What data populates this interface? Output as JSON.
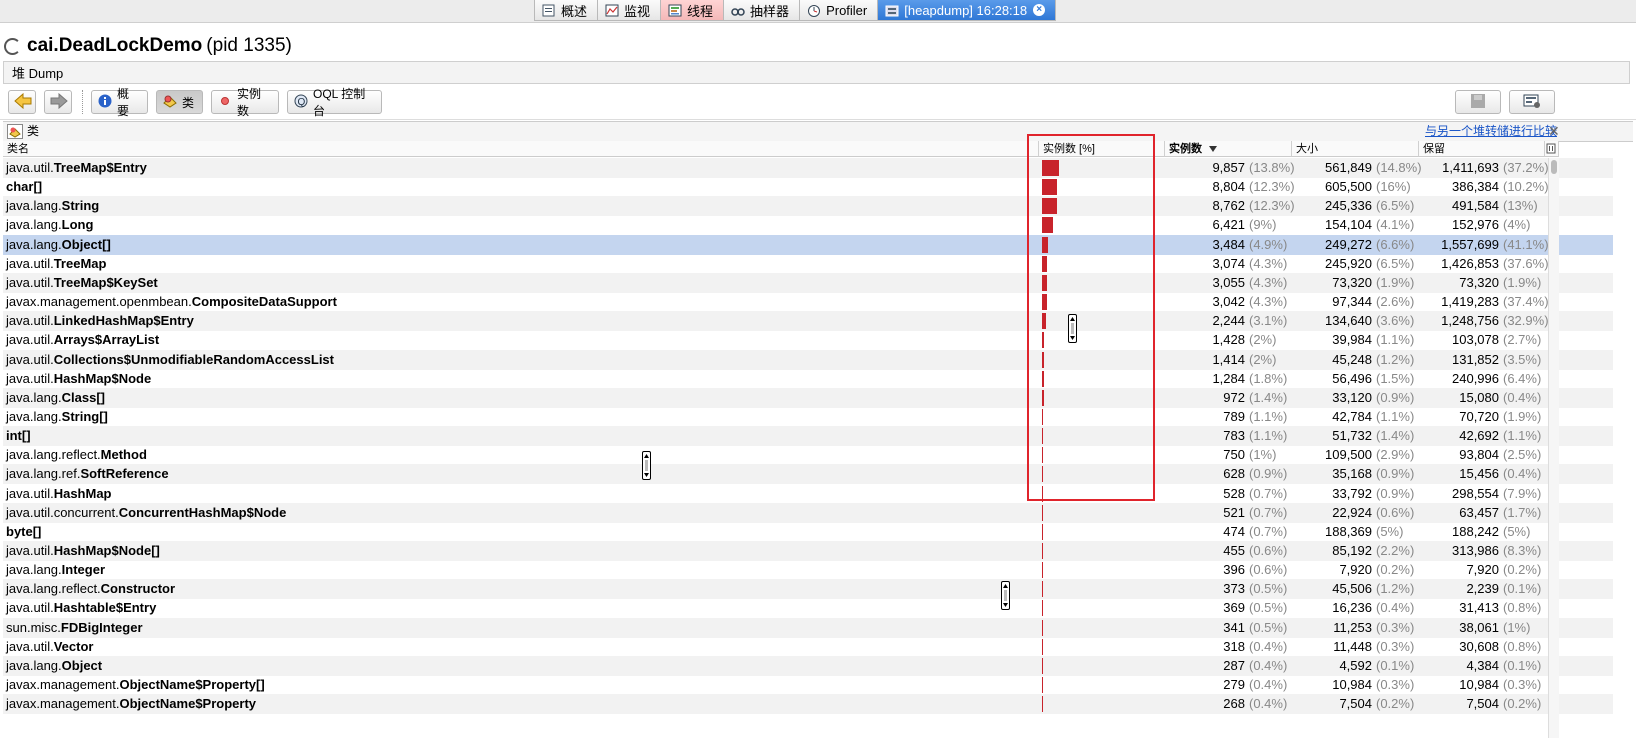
{
  "tabs": [
    {
      "label": "概述",
      "icon": "overview-icon"
    },
    {
      "label": "监视",
      "icon": "monitor-icon"
    },
    {
      "label": "线程",
      "icon": "threads-icon"
    },
    {
      "label": "抽样器",
      "icon": "sampler-icon"
    },
    {
      "label": "Profiler",
      "icon": "profiler-icon"
    },
    {
      "label": "[heapdump] 16:28:18",
      "icon": "heapdump-icon"
    }
  ],
  "app": {
    "name": "cai.DeadLockDemo",
    "pid": "(pid 1335)"
  },
  "heap_dump_label": "堆 Dump",
  "toolbar": {
    "summary": "概要",
    "classes": "类",
    "instances": "实例数",
    "oql": "OQL 控制台"
  },
  "classes_panel": {
    "title": "类",
    "compare_link": "与另一个堆转储进行比较"
  },
  "columns": {
    "name": "类名",
    "instances_pct": "实例数 [%]",
    "instances": "实例数",
    "size": "大小",
    "retained": "保留"
  },
  "rows": [
    {
      "pkg": "java.util.",
      "cls": "TreeMap$Entry",
      "bar": 13.8,
      "inst": "9,857",
      "inst_pct": "(13.8%)",
      "size": "561,849",
      "size_pct": "(14.8%)",
      "ret": "1,411,693",
      "ret_pct": "(37.2%)"
    },
    {
      "pkg": "",
      "cls": "char[]",
      "bar": 12.3,
      "inst": "8,804",
      "inst_pct": "(12.3%)",
      "size": "605,500",
      "size_pct": "(16%)",
      "ret": "386,384",
      "ret_pct": "(10.2%)"
    },
    {
      "pkg": "java.lang.",
      "cls": "String",
      "bar": 12.3,
      "inst": "8,762",
      "inst_pct": "(12.3%)",
      "size": "245,336",
      "size_pct": "(6.5%)",
      "ret": "491,584",
      "ret_pct": "(13%)"
    },
    {
      "pkg": "java.lang.",
      "cls": "Long",
      "bar": 9,
      "inst": "6,421",
      "inst_pct": "(9%)",
      "size": "154,104",
      "size_pct": "(4.1%)",
      "ret": "152,976",
      "ret_pct": "(4%)"
    },
    {
      "pkg": "java.lang.",
      "cls": "Object[]",
      "bar": 4.9,
      "inst": "3,484",
      "inst_pct": "(4.9%)",
      "size": "249,272",
      "size_pct": "(6.6%)",
      "ret": "1,557,699",
      "ret_pct": "(41.1%)",
      "selected": true
    },
    {
      "pkg": "java.util.",
      "cls": "TreeMap",
      "bar": 4.3,
      "inst": "3,074",
      "inst_pct": "(4.3%)",
      "size": "245,920",
      "size_pct": "(6.5%)",
      "ret": "1,426,853",
      "ret_pct": "(37.6%)"
    },
    {
      "pkg": "java.util.",
      "cls": "TreeMap$KeySet",
      "bar": 4.3,
      "inst": "3,055",
      "inst_pct": "(4.3%)",
      "size": "73,320",
      "size_pct": "(1.9%)",
      "ret": "73,320",
      "ret_pct": "(1.9%)"
    },
    {
      "pkg": "javax.management.openmbean.",
      "cls": "CompositeDataSupport",
      "bar": 4.3,
      "inst": "3,042",
      "inst_pct": "(4.3%)",
      "size": "97,344",
      "size_pct": "(2.6%)",
      "ret": "1,419,283",
      "ret_pct": "(37.4%)"
    },
    {
      "pkg": "java.util.",
      "cls": "LinkedHashMap$Entry",
      "bar": 3.1,
      "inst": "2,244",
      "inst_pct": "(3.1%)",
      "size": "134,640",
      "size_pct": "(3.6%)",
      "ret": "1,248,756",
      "ret_pct": "(32.9%)"
    },
    {
      "pkg": "java.util.",
      "cls": "Arrays$ArrayList",
      "bar": 2,
      "inst": "1,428",
      "inst_pct": "(2%)",
      "size": "39,984",
      "size_pct": "(1.1%)",
      "ret": "103,078",
      "ret_pct": "(2.7%)"
    },
    {
      "pkg": "java.util.",
      "cls": "Collections$UnmodifiableRandomAccessList",
      "bar": 2,
      "inst": "1,414",
      "inst_pct": "(2%)",
      "size": "45,248",
      "size_pct": "(1.2%)",
      "ret": "131,852",
      "ret_pct": "(3.5%)"
    },
    {
      "pkg": "java.util.",
      "cls": "HashMap$Node",
      "bar": 1.8,
      "inst": "1,284",
      "inst_pct": "(1.8%)",
      "size": "56,496",
      "size_pct": "(1.5%)",
      "ret": "240,996",
      "ret_pct": "(6.4%)"
    },
    {
      "pkg": "java.lang.",
      "cls": "Class[]",
      "bar": 1.4,
      "inst": "972",
      "inst_pct": "(1.4%)",
      "size": "33,120",
      "size_pct": "(0.9%)",
      "ret": "15,080",
      "ret_pct": "(0.4%)"
    },
    {
      "pkg": "java.lang.",
      "cls": "String[]",
      "bar": 1.1,
      "inst": "789",
      "inst_pct": "(1.1%)",
      "size": "42,784",
      "size_pct": "(1.1%)",
      "ret": "70,720",
      "ret_pct": "(1.9%)"
    },
    {
      "pkg": "",
      "cls": "int[]",
      "bar": 1.1,
      "inst": "783",
      "inst_pct": "(1.1%)",
      "size": "51,732",
      "size_pct": "(1.4%)",
      "ret": "42,692",
      "ret_pct": "(1.1%)"
    },
    {
      "pkg": "java.lang.reflect.",
      "cls": "Method",
      "bar": 1,
      "inst": "750",
      "inst_pct": "(1%)",
      "size": "109,500",
      "size_pct": "(2.9%)",
      "ret": "93,804",
      "ret_pct": "(2.5%)"
    },
    {
      "pkg": "java.lang.ref.",
      "cls": "SoftReference",
      "bar": 0.9,
      "inst": "628",
      "inst_pct": "(0.9%)",
      "size": "35,168",
      "size_pct": "(0.9%)",
      "ret": "15,456",
      "ret_pct": "(0.4%)"
    },
    {
      "pkg": "java.util.",
      "cls": "HashMap",
      "bar": 0.7,
      "inst": "528",
      "inst_pct": "(0.7%)",
      "size": "33,792",
      "size_pct": "(0.9%)",
      "ret": "298,554",
      "ret_pct": "(7.9%)"
    },
    {
      "pkg": "java.util.concurrent.",
      "cls": "ConcurrentHashMap$Node",
      "bar": 0.7,
      "inst": "521",
      "inst_pct": "(0.7%)",
      "size": "22,924",
      "size_pct": "(0.6%)",
      "ret": "63,457",
      "ret_pct": "(1.7%)"
    },
    {
      "pkg": "",
      "cls": "byte[]",
      "bar": 0.7,
      "inst": "474",
      "inst_pct": "(0.7%)",
      "size": "188,369",
      "size_pct": "(5%)",
      "ret": "188,242",
      "ret_pct": "(5%)"
    },
    {
      "pkg": "java.util.",
      "cls": "HashMap$Node[]",
      "bar": 0.6,
      "inst": "455",
      "inst_pct": "(0.6%)",
      "size": "85,192",
      "size_pct": "(2.2%)",
      "ret": "313,986",
      "ret_pct": "(8.3%)"
    },
    {
      "pkg": "java.lang.",
      "cls": "Integer",
      "bar": 0.6,
      "inst": "396",
      "inst_pct": "(0.6%)",
      "size": "7,920",
      "size_pct": "(0.2%)",
      "ret": "7,920",
      "ret_pct": "(0.2%)"
    },
    {
      "pkg": "java.lang.reflect.",
      "cls": "Constructor",
      "bar": 0.5,
      "inst": "373",
      "inst_pct": "(0.5%)",
      "size": "45,506",
      "size_pct": "(1.2%)",
      "ret": "2,239",
      "ret_pct": "(0.1%)"
    },
    {
      "pkg": "java.util.",
      "cls": "Hashtable$Entry",
      "bar": 0.5,
      "inst": "369",
      "inst_pct": "(0.5%)",
      "size": "16,236",
      "size_pct": "(0.4%)",
      "ret": "31,413",
      "ret_pct": "(0.8%)"
    },
    {
      "pkg": "sun.misc.",
      "cls": "FDBigInteger",
      "bar": 0.5,
      "inst": "341",
      "inst_pct": "(0.5%)",
      "size": "11,253",
      "size_pct": "(0.3%)",
      "ret": "38,061",
      "ret_pct": "(1%)"
    },
    {
      "pkg": "java.util.",
      "cls": "Vector",
      "bar": 0.4,
      "inst": "318",
      "inst_pct": "(0.4%)",
      "size": "11,448",
      "size_pct": "(0.3%)",
      "ret": "30,608",
      "ret_pct": "(0.8%)"
    },
    {
      "pkg": "java.lang.",
      "cls": "Object",
      "bar": 0.4,
      "inst": "287",
      "inst_pct": "(0.4%)",
      "size": "4,592",
      "size_pct": "(0.1%)",
      "ret": "4,384",
      "ret_pct": "(0.1%)"
    },
    {
      "pkg": "javax.management.",
      "cls": "ObjectName$Property[]",
      "bar": 0.4,
      "inst": "279",
      "inst_pct": "(0.4%)",
      "size": "10,984",
      "size_pct": "(0.3%)",
      "ret": "10,984",
      "ret_pct": "(0.3%)"
    },
    {
      "pkg": "javax.management.",
      "cls": "ObjectName$Property",
      "bar": 0.4,
      "inst": "268",
      "inst_pct": "(0.4%)",
      "size": "7,504",
      "size_pct": "(0.2%)",
      "ret": "7,504",
      "ret_pct": "(0.2%)"
    }
  ]
}
